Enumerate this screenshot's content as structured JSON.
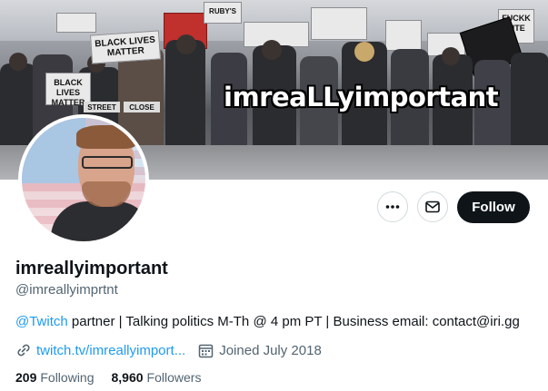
{
  "banner": {
    "overlay_text": "imreaLLyimportant",
    "signs": [
      "BLACK LIVES MATTER",
      "BLACK LIVES MATTER",
      "STREET",
      "CLOSE",
      "FUCKK\nLITE",
      "RUBY'S"
    ]
  },
  "profile": {
    "display_name": "imreallyimportant",
    "handle": "@imreallyimprtnt",
    "bio": {
      "mention": "@Twitch",
      "text": " partner | Talking politics M-Th @ 4 pm PT | Business email: contact@iri.gg"
    },
    "website": "twitch.tv/imreallyimport...",
    "joined": "Joined July 2018",
    "following_count": "209",
    "following_label": "Following",
    "followers_count": "8,960",
    "followers_label": "Followers"
  },
  "actions": {
    "more_icon": "more-dots-icon",
    "message_icon": "envelope-icon",
    "follow_label": "Follow"
  },
  "colors": {
    "accent": "#1d9bf0",
    "follow_button_bg": "#0f1419",
    "secondary_text": "#536471"
  }
}
